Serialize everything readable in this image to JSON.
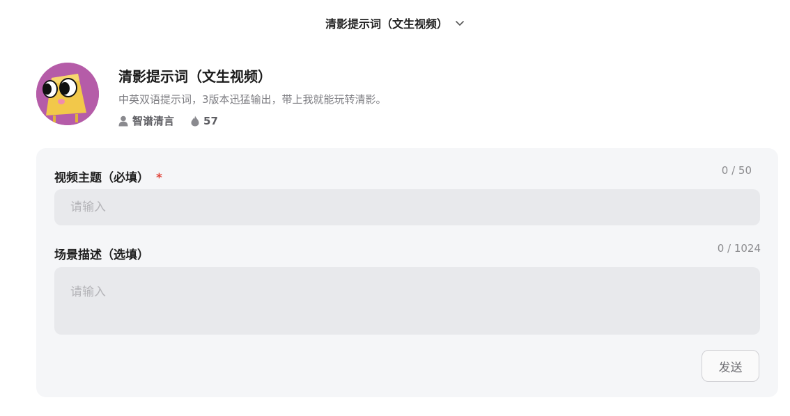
{
  "topbar": {
    "title": "清影提示词（文生视频）",
    "dropdown_icon": "chevron-down-icon"
  },
  "agent": {
    "name": "清影提示词（文生视频）",
    "description": "中英双语提示词，3版本迅猛输出，带上我就能玩转清影。",
    "author": "智谱清言",
    "usage_count": "57",
    "author_icon": "user-icon",
    "usage_icon": "flame-icon",
    "avatar_colors": {
      "background": "#b55ca8",
      "body": "#f2c84a"
    }
  },
  "form": {
    "topic": {
      "label": "视频主题（必填）",
      "required_mark": "*",
      "count": "0 / 50",
      "placeholder": "请输入"
    },
    "scene": {
      "label": "场景描述（选填）",
      "count": "0 / 1024",
      "placeholder": "请输入"
    },
    "send_label": "发送"
  },
  "colors": {
    "card_bg": "#f5f6f8",
    "input_bg": "#e8e9ec",
    "required": "#e0443a"
  }
}
